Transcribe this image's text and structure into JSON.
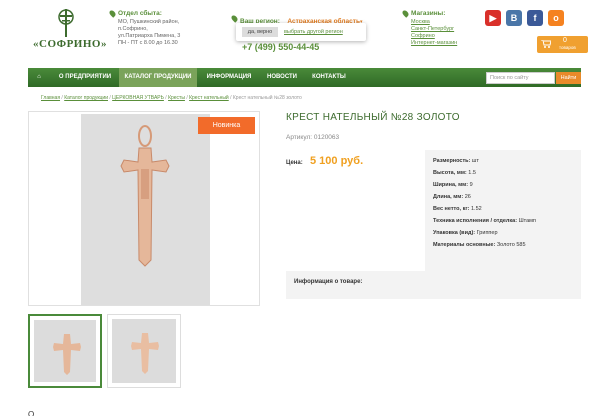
{
  "header": {
    "logo_text": "«СОФРИНО»",
    "sales_title": "Отдел сбыта:",
    "sales_lines": [
      "МО, Пушкинский район,",
      "п.Софрино,",
      "ул.Патриарха Пимена, 3",
      "ПН - ПТ с 8.00 до 16.30"
    ],
    "region_label": "Ваш регион:",
    "region_value": "Астраханская область",
    "region_confirm": "да, верно",
    "region_other": "выбрать другой регион",
    "phone": "+7 (499) 550-44-45",
    "stores_title": "Магазины:",
    "stores": [
      "Москва",
      "Санкт-Петербург",
      "Софрино",
      "Интернет-магазин"
    ],
    "social": [
      {
        "icon": "youtube-icon",
        "glyph": "▶",
        "color": "#d9302a"
      },
      {
        "icon": "vk-icon",
        "glyph": "В",
        "color": "#4a76a8"
      },
      {
        "icon": "facebook-icon",
        "glyph": "f",
        "color": "#3b5998"
      },
      {
        "icon": "odnoklassniki-icon",
        "glyph": "о",
        "color": "#f58220"
      }
    ],
    "cart_count": "0",
    "cart_label": "товаров"
  },
  "nav": {
    "items": [
      "О ПРЕДПРИЯТИИ",
      "КАТАЛОГ ПРОДУКЦИИ",
      "ИНФОРМАЦИЯ",
      "НОВОСТИ",
      "КОНТАКТЫ"
    ],
    "search_placeholder": "Поиск по сайту",
    "search_button": "Найти"
  },
  "breadcrumbs": [
    "Главная",
    "Каталог продукции",
    "ЦЕРКОВНАЯ УТВАРЬ",
    "Кресты",
    "Крест нательный",
    "Крест нательный №28 золото"
  ],
  "product": {
    "badge": "Новинка",
    "title": "КРЕСТ НАТЕЛЬНЫЙ №28 ЗОЛОТО",
    "sku": "Артикул: 0120063",
    "price_label": "Цена:",
    "price": "5 100 руб.",
    "props": [
      {
        "k": "Размерность:",
        "v": " шт"
      },
      {
        "k": "Высота, мм:",
        "v": " 1.5"
      },
      {
        "k": "Ширина, мм:",
        "v": " 9"
      },
      {
        "k": "Длина, мм:",
        "v": " 26"
      },
      {
        "k": "Вес нетто, кг:",
        "v": " 1.52"
      },
      {
        "k": "Техника исполнения / отделка:",
        "v": " Штамп"
      },
      {
        "k": "Упаковка (вид):",
        "v": " Гриппер"
      },
      {
        "k": "Материалы основные:",
        "v": " Золото 585"
      }
    ],
    "info_title": "Информация о товаре:",
    "bottom_text": "О"
  },
  "colors": {
    "brand_green": "#4a8a3a",
    "accent_orange": "#f26b2a",
    "price": "#f0a020"
  }
}
